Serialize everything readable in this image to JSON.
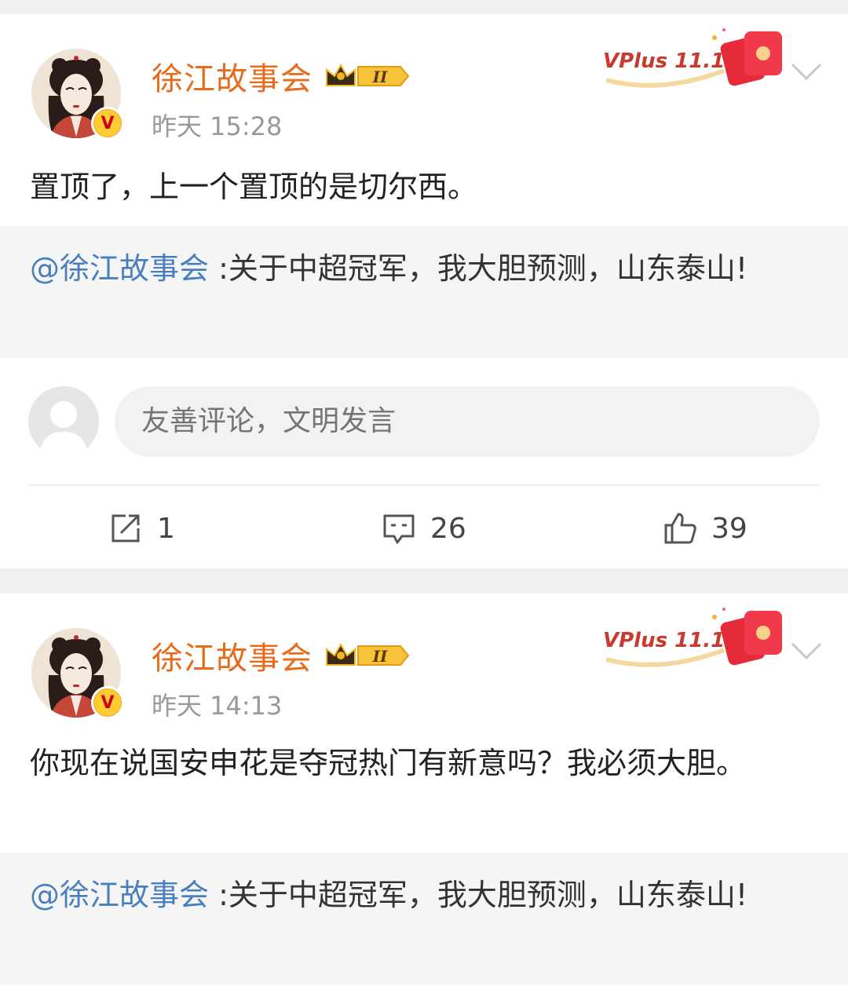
{
  "posts": [
    {
      "author": "徐江故事会",
      "vip_level": "II",
      "time": "昨天 15:28",
      "text": "置顶了，上一个置顶的是切尔西。",
      "quote_mention": "@徐江故事会",
      "quote_text": " :关于中超冠军，我大胆预测，山东泰山!",
      "promo": "VPlus 11.11",
      "comment_placeholder": "友善评论，文明发言",
      "share_count": "1",
      "comment_count": "26",
      "like_count": "39"
    },
    {
      "author": "徐江故事会",
      "vip_level": "II",
      "time": "昨天 14:13",
      "text": "你现在说国安申花是夺冠热门有新意吗？我必须大胆。",
      "quote_mention": "@徐江故事会",
      "quote_text": " :关于中超冠军，我大胆预测，山东泰山!",
      "promo": "VPlus 11.11"
    }
  ],
  "colors": {
    "username": "#e86b1c",
    "mention": "#4a7fbd",
    "time": "#999999",
    "background": "#f0f0f0"
  },
  "icons": [
    "verified-v-icon",
    "crown-vip-icon",
    "chevron-down-icon",
    "share-icon",
    "comment-icon",
    "like-icon",
    "default-avatar-icon"
  ]
}
